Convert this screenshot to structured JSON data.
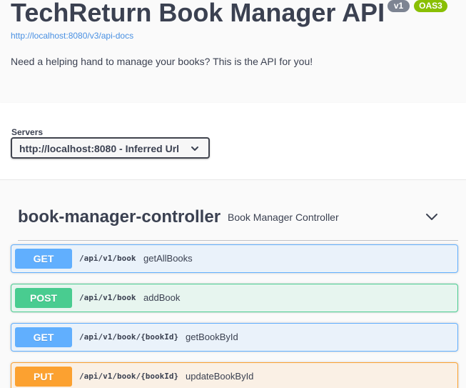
{
  "info": {
    "title": "TechReturn Book Manager API",
    "version_badge": "v1",
    "oas_badge": "OAS3",
    "spec_link": "http://localhost:8080/v3/api-docs",
    "description": "Need a helping hand to manage your books? This is the API for you!"
  },
  "servers": {
    "label": "Servers",
    "selected": "http://localhost:8080 - Inferred Url"
  },
  "tag": {
    "name": "book-manager-controller",
    "description": "Book Manager Controller",
    "expanded": true
  },
  "operations": [
    {
      "method": "GET",
      "path": "/api/v1/book",
      "summary": "getAllBooks"
    },
    {
      "method": "POST",
      "path": "/api/v1/book",
      "summary": "addBook"
    },
    {
      "method": "GET",
      "path": "/api/v1/book/{bookId}",
      "summary": "getBookById"
    },
    {
      "method": "PUT",
      "path": "/api/v1/book/{bookId}",
      "summary": "updateBookById"
    }
  ],
  "colors": {
    "get": "#61affe",
    "post": "#49cc90",
    "put": "#fca130",
    "link": "#4990e2",
    "oas_badge": "#89bf04",
    "version_badge": "#7d8492"
  }
}
